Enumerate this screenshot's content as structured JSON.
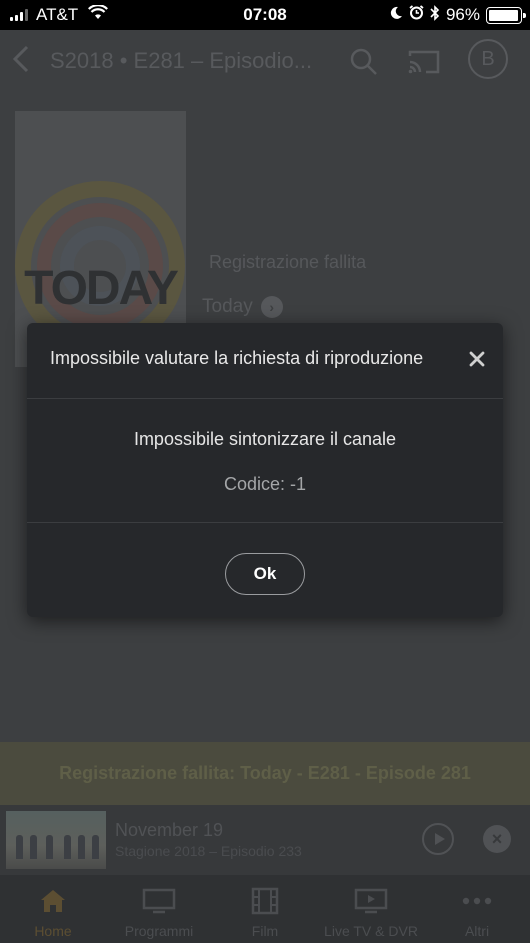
{
  "status_bar": {
    "carrier": "AT&T",
    "time": "07:08",
    "battery": "96%",
    "battery_level": 0.96
  },
  "header": {
    "title": "S2018 • E281 – Episodio...",
    "avatar_letter": "B"
  },
  "background": {
    "poster_logo": "TODAY",
    "recording_status": "Registrazione fallita",
    "show_link": "Today",
    "banner": "Registrazione fallita: Today - E281 - Episode 281"
  },
  "mini_player": {
    "title": "November 19",
    "subtitle": "Stagione 2018 – Episodio 233"
  },
  "tabs": [
    {
      "label": "Home",
      "icon": "home-icon",
      "active": true
    },
    {
      "label": "Programmi",
      "icon": "tv-icon",
      "active": false
    },
    {
      "label": "Film",
      "icon": "film-icon",
      "active": false
    },
    {
      "label": "Live TV & DVR",
      "icon": "live-tv-icon",
      "active": false
    },
    {
      "label": "Altri",
      "icon": "more-icon",
      "active": false
    }
  ],
  "dialog": {
    "title": "Impossibile valutare la richiesta di riproduzione",
    "message": "Impossibile sintonizzare il canale",
    "code": "Codice: -1",
    "ok_label": "Ok"
  }
}
